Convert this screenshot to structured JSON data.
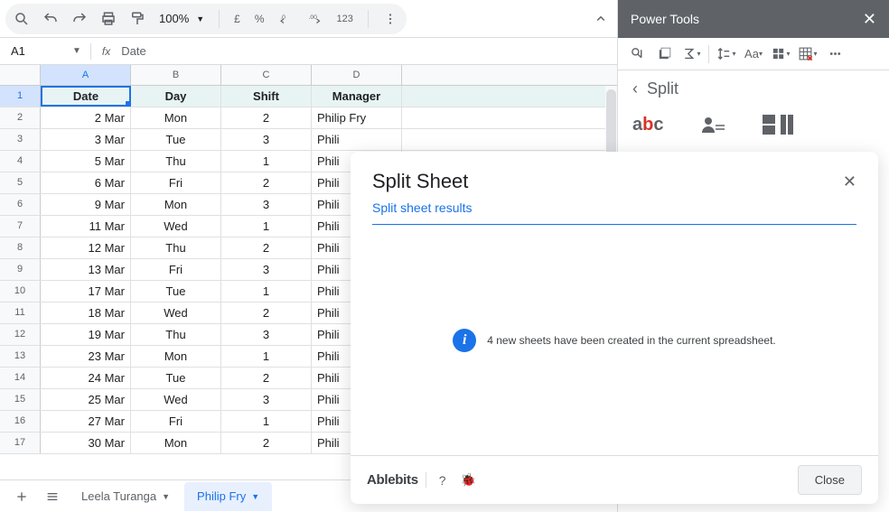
{
  "toolbar": {
    "zoom": "100%",
    "pound": "£",
    "percent": "%",
    "num_format": "123"
  },
  "formula_bar": {
    "name_box": "A1",
    "content": "Date"
  },
  "columns": [
    "A",
    "B",
    "C",
    "D"
  ],
  "headers": {
    "A": "Date",
    "B": "Day",
    "C": "Shift",
    "D": "Manager"
  },
  "chart_data": {
    "type": "table",
    "columns": [
      "Date",
      "Day",
      "Shift",
      "Manager"
    ],
    "rows": [
      {
        "Date": "2 Mar",
        "Day": "Mon",
        "Shift": 2,
        "Manager": "Philip Fry"
      },
      {
        "Date": "3 Mar",
        "Day": "Tue",
        "Shift": 3,
        "Manager": "Phili"
      },
      {
        "Date": "5 Mar",
        "Day": "Thu",
        "Shift": 1,
        "Manager": "Phili"
      },
      {
        "Date": "6 Mar",
        "Day": "Fri",
        "Shift": 2,
        "Manager": "Phili"
      },
      {
        "Date": "9 Mar",
        "Day": "Mon",
        "Shift": 3,
        "Manager": "Phili"
      },
      {
        "Date": "11 Mar",
        "Day": "Wed",
        "Shift": 1,
        "Manager": "Phili"
      },
      {
        "Date": "12 Mar",
        "Day": "Thu",
        "Shift": 2,
        "Manager": "Phili"
      },
      {
        "Date": "13 Mar",
        "Day": "Fri",
        "Shift": 3,
        "Manager": "Phili"
      },
      {
        "Date": "17 Mar",
        "Day": "Tue",
        "Shift": 1,
        "Manager": "Phili"
      },
      {
        "Date": "18 Mar",
        "Day": "Wed",
        "Shift": 2,
        "Manager": "Phili"
      },
      {
        "Date": "19 Mar",
        "Day": "Thu",
        "Shift": 3,
        "Manager": "Phili"
      },
      {
        "Date": "23 Mar",
        "Day": "Mon",
        "Shift": 1,
        "Manager": "Phili"
      },
      {
        "Date": "24 Mar",
        "Day": "Tue",
        "Shift": 2,
        "Manager": "Phili"
      },
      {
        "Date": "25 Mar",
        "Day": "Wed",
        "Shift": 3,
        "Manager": "Phili"
      },
      {
        "Date": "27 Mar",
        "Day": "Fri",
        "Shift": 1,
        "Manager": "Phili"
      },
      {
        "Date": "30 Mar",
        "Day": "Mon",
        "Shift": 2,
        "Manager": "Phili"
      }
    ]
  },
  "sheets": {
    "tab1": "Leela Turanga",
    "tab2": "Philip Fry"
  },
  "sidebar": {
    "title": "Power Tools",
    "breadcrumb": "Split"
  },
  "popup": {
    "title": "Split Sheet",
    "subtitle": "Split sheet results",
    "message": "4 new sheets have been created in the current spreadsheet.",
    "brand": "Ablebits",
    "close": "Close"
  }
}
